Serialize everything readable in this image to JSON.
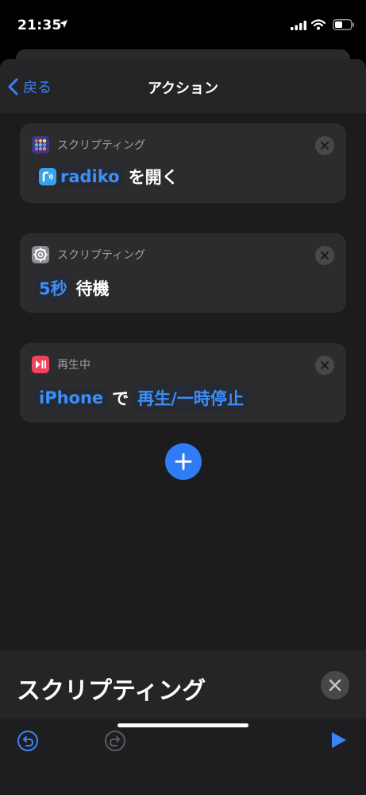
{
  "status": {
    "time": "21:35"
  },
  "nav": {
    "back_label": "戻る",
    "title": "アクション"
  },
  "actions": [
    {
      "category": "スクリプティング",
      "app": "radiko",
      "suffix": "を開く"
    },
    {
      "category": "スクリプティング",
      "duration": "5秒",
      "suffix": "待機"
    },
    {
      "category": "再生中",
      "device": "iPhone",
      "connector": "で",
      "command": "再生/一時停止"
    }
  ],
  "bottom_panel": {
    "title": "スクリプティング"
  },
  "colors": {
    "accent": "#3d8ef7",
    "sheet": "#1c1c1e",
    "card": "#2c2c2e"
  },
  "icons": [
    "location-arrow-icon",
    "signal-icon",
    "wifi-icon",
    "battery-icon",
    "chevron-left-icon",
    "grid-apps-icon",
    "gear-icon",
    "play-pause-icon",
    "radiko-icon",
    "close-icon",
    "plus-icon",
    "undo-icon",
    "redo-icon",
    "play-icon"
  ]
}
